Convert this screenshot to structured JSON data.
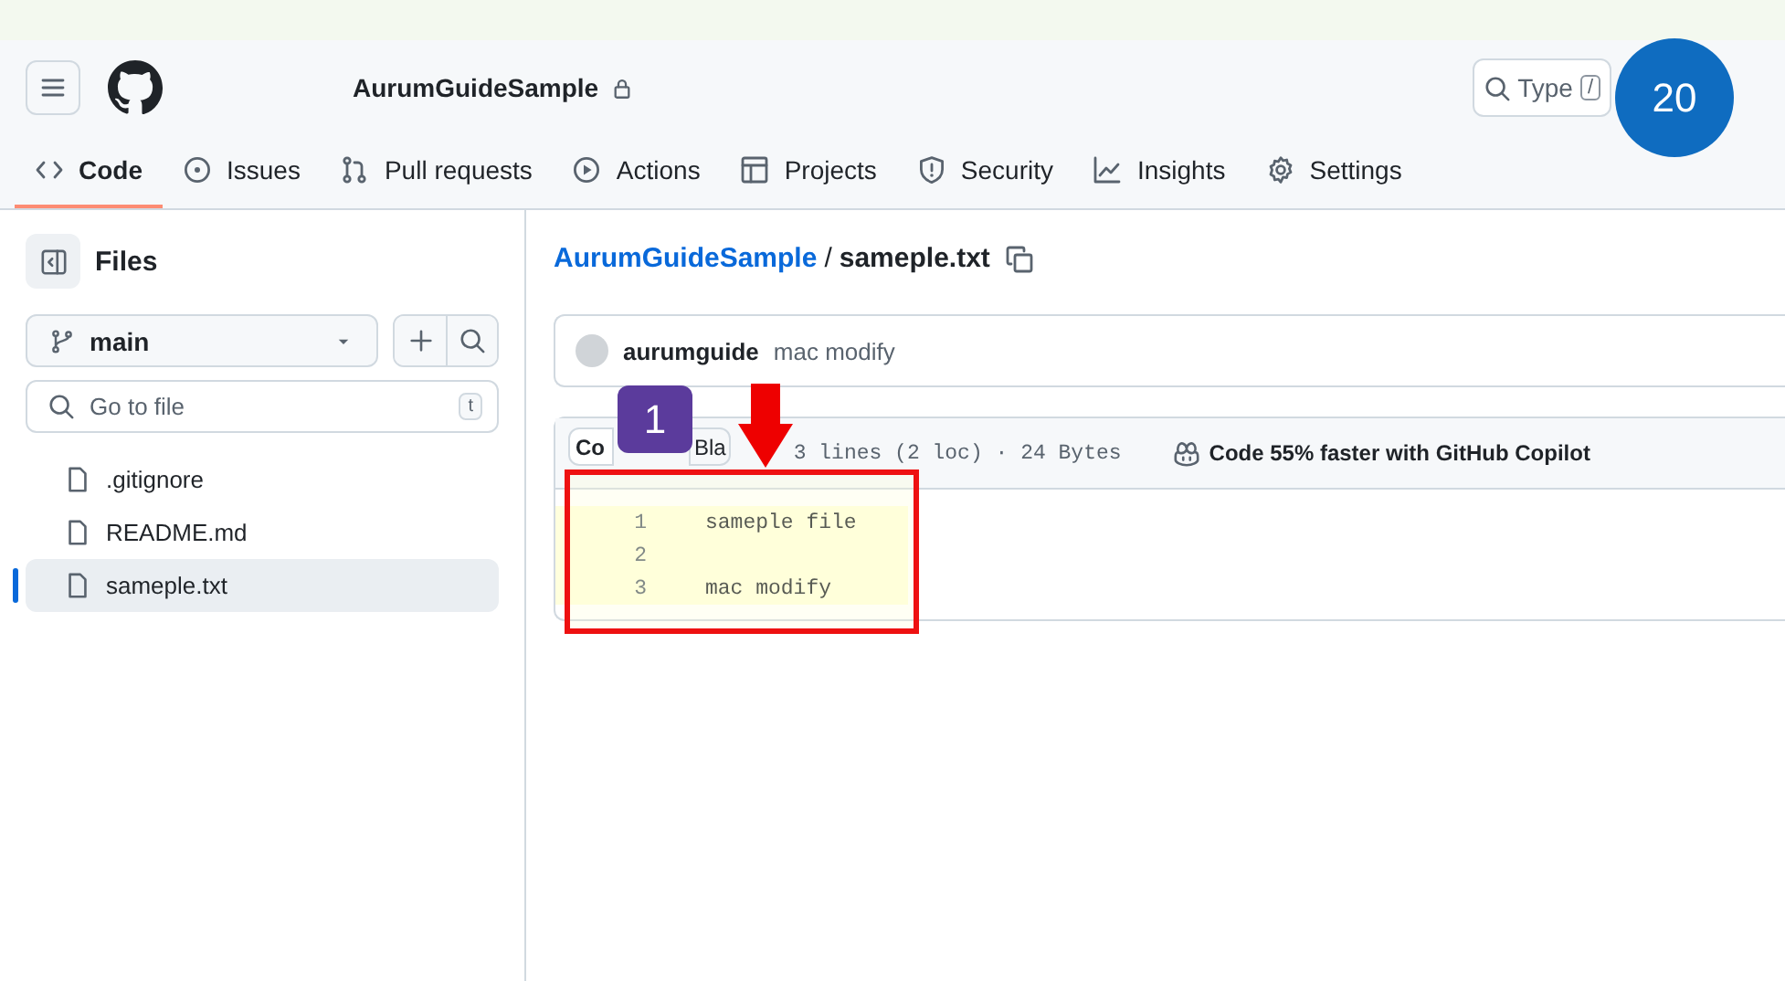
{
  "header": {
    "repo": "AurumGuideSample",
    "search_placeholder": "Type",
    "search_key": "/"
  },
  "nav": [
    {
      "label": "Code",
      "selected": true
    },
    {
      "label": "Issues",
      "selected": false
    },
    {
      "label": "Pull requests",
      "selected": false
    },
    {
      "label": "Actions",
      "selected": false
    },
    {
      "label": "Projects",
      "selected": false
    },
    {
      "label": "Security",
      "selected": false
    },
    {
      "label": "Insights",
      "selected": false
    },
    {
      "label": "Settings",
      "selected": false
    }
  ],
  "sidebar": {
    "title": "Files",
    "branch": "main",
    "go_to_file": {
      "placeholder": "Go to file",
      "key": "t"
    },
    "files": [
      {
        "name": ".gitignore",
        "selected": false
      },
      {
        "name": "README.md",
        "selected": false
      },
      {
        "name": "sameple.txt",
        "selected": true
      }
    ]
  },
  "breadcrumb": {
    "repo": "AurumGuideSample",
    "separator": "/",
    "file": "sameple.txt"
  },
  "commit": {
    "author": "aurumguide",
    "message": "mac modify"
  },
  "file_view": {
    "tabs": [
      {
        "label": "Co",
        "selected": true
      },
      {
        "label": "Bla",
        "selected": false
      }
    ],
    "info": "3 lines (2 loc) · 24 Bytes",
    "copilot": "Code 55% faster with GitHub Copilot",
    "lines": [
      {
        "number": "1",
        "text": "sameple file",
        "highlighted": true
      },
      {
        "number": "2",
        "highlighted": true
      },
      {
        "number": "3",
        "text": "mac modify",
        "highlighted": true
      }
    ]
  },
  "annotations": [
    {
      "kind": "circle",
      "label": "20"
    },
    {
      "kind": "square",
      "label": "1"
    }
  ]
}
